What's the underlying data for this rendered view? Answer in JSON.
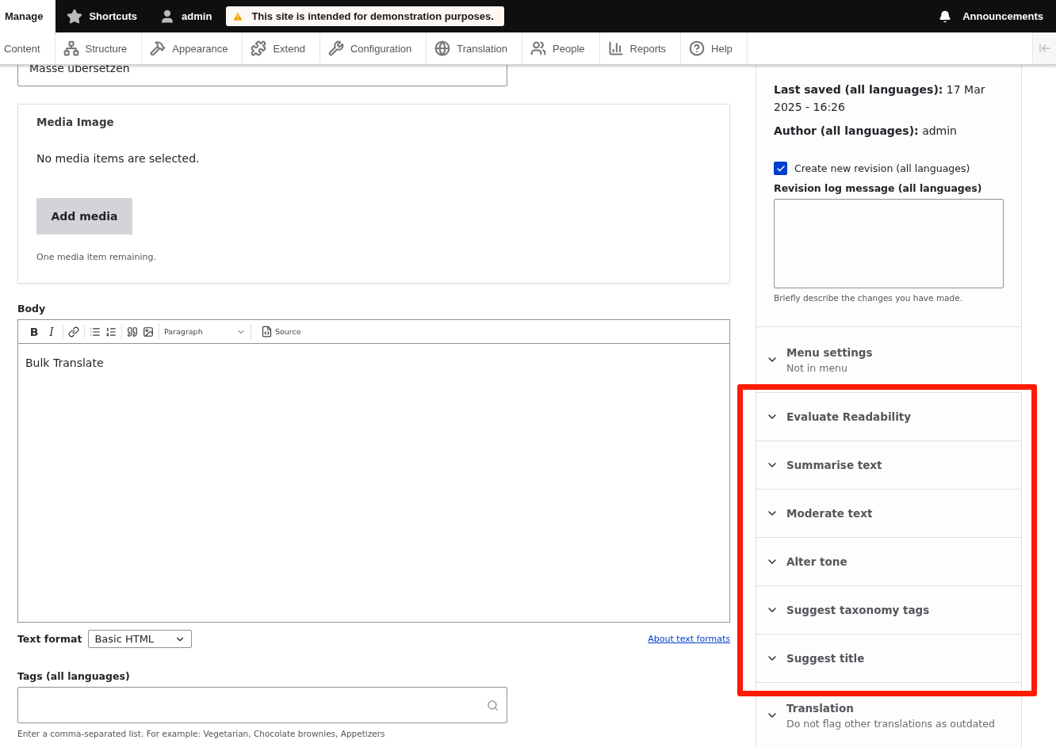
{
  "toolbar": {
    "tabs": [
      {
        "label": "Manage",
        "selected": true
      },
      {
        "label": "Shortcuts",
        "selected": false
      },
      {
        "label": "admin",
        "selected": false
      }
    ],
    "notice": "This site is intended for demonstration purposes.",
    "announcements": "Announcements"
  },
  "menu": [
    {
      "label": "Content"
    },
    {
      "label": "Structure"
    },
    {
      "label": "Appearance"
    },
    {
      "label": "Extend"
    },
    {
      "label": "Configuration"
    },
    {
      "label": "Translation"
    },
    {
      "label": "People"
    },
    {
      "label": "Reports"
    },
    {
      "label": "Help"
    }
  ],
  "title_field": {
    "value": "Masse übersetzen"
  },
  "media": {
    "title": "Media Image",
    "empty": "No media items are selected.",
    "button": "Add media",
    "remaining": "One media item remaining."
  },
  "body": {
    "label": "Body",
    "tool_groups": [
      [
        {
          "kind": "bold",
          "label": "B"
        },
        {
          "kind": "italic",
          "label": "I"
        }
      ],
      [
        {
          "kind": "link"
        }
      ],
      [
        {
          "kind": "bullets"
        },
        {
          "kind": "numbers"
        }
      ],
      [
        {
          "kind": "quote"
        },
        {
          "kind": "image"
        }
      ]
    ],
    "heading_select": "Paragraph",
    "source": "Source",
    "content": "Bulk Translate"
  },
  "text_format": {
    "label": "Text format",
    "value": "Basic HTML",
    "link": "About text formats"
  },
  "tags": {
    "label": "Tags (all languages)",
    "help": "Enter a comma-separated list. For example: Vegetarian, Chocolate brownies, Appetizers"
  },
  "sidebar": {
    "meta": [
      {
        "label": "Last saved (all languages):",
        "value": "17 Mar 2025 - 16:26"
      },
      {
        "label": "Author (all languages):",
        "value": "admin"
      }
    ],
    "revision": {
      "label": "Create new revision (all languages)",
      "checked": true
    },
    "log": {
      "label": "Revision log message (all languages)",
      "help": "Briefly describe the changes you have made."
    },
    "sections": [
      {
        "title": "Menu settings",
        "summary": "Not in menu"
      }
    ],
    "highlighted_sections": [
      {
        "title": "Evaluate Readability"
      },
      {
        "title": "Summarise text"
      },
      {
        "title": "Moderate text"
      },
      {
        "title": "Alter tone"
      },
      {
        "title": "Suggest taxonomy tags"
      },
      {
        "title": "Suggest title"
      }
    ],
    "more_sections": [
      {
        "title": "Translation",
        "summary": "Do not flag other translations as outdated"
      }
    ]
  }
}
